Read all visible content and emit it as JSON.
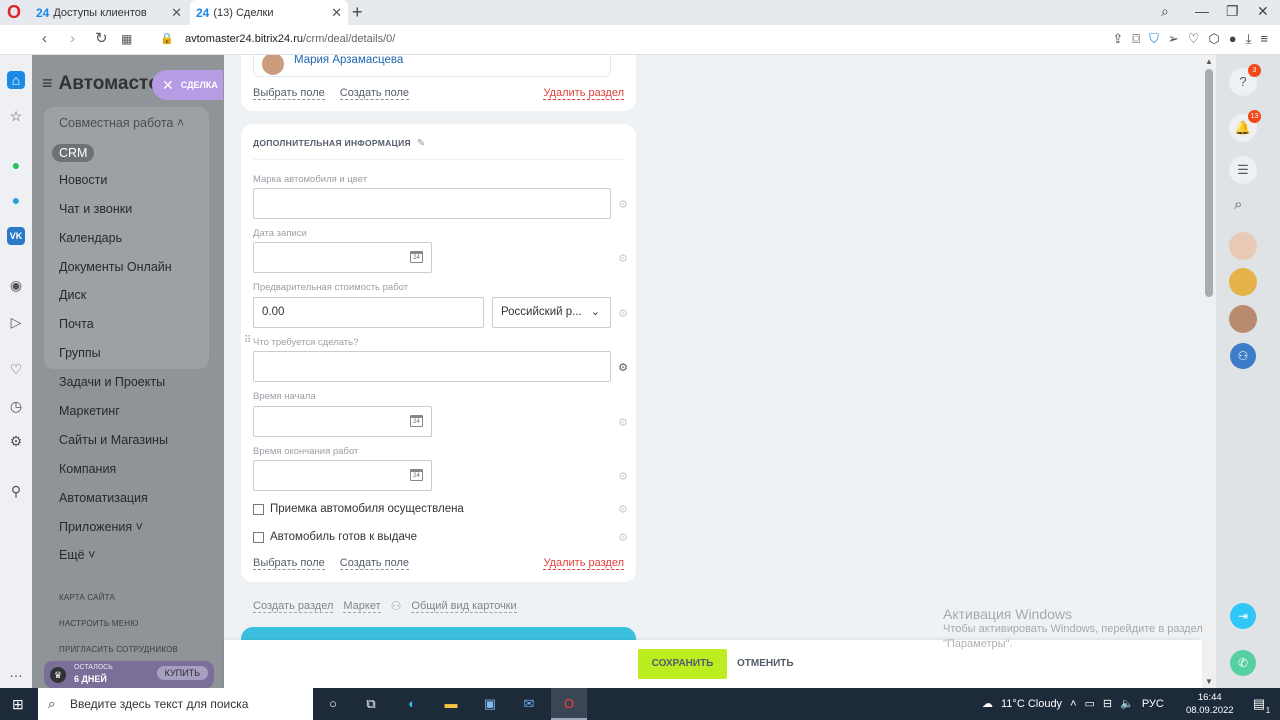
{
  "browser": {
    "tabs": [
      {
        "icon_text": "24",
        "title": "Доступы клиентов",
        "active": false
      },
      {
        "icon_text": "24",
        "title": "(13) Сделки",
        "active": true
      }
    ],
    "url_host": "avtomaster24.bitrix24.ru",
    "url_path": "/crm/deal/details/0/"
  },
  "leftmenu": {
    "brand": "Автомастер",
    "group_label": "Совместная работа",
    "group_items": [
      "CRM",
      "Новости",
      "Чат и звонки",
      "Календарь",
      "Документы Онлайн",
      "Диск",
      "Почта",
      "Группы"
    ],
    "items": [
      "Задачи и Проекты",
      "Маркетинг",
      "Сайты и Магазины",
      "Компания",
      "Автоматизация",
      "Приложения",
      "Ещё"
    ],
    "small_links": [
      "КАРТА САЙТА",
      "НАСТРОИТЬ МЕНЮ",
      "ПРИГЛАСИТЬ СОТРУДНИКОВ"
    ],
    "promo": {
      "line1": "ОСТАЛОСЬ",
      "line2": "6 ДНЕЙ",
      "buy": "КУПИТЬ"
    }
  },
  "slider_chip": {
    "label": "СДЕЛКА"
  },
  "card1": {
    "person_name": "Мария Арзамасцева",
    "select_field": "Выбрать поле",
    "create_field": "Создать поле",
    "delete_section": "Удалить раздел"
  },
  "card2": {
    "title": "ДОПОЛНИТЕЛЬНАЯ ИНФОРМАЦИЯ",
    "fields": {
      "car_label": "Марка автомобиля и цвет",
      "date_label": "Дата записи",
      "cost_label": "Предварительная стоимость работ",
      "cost_value": "0.00",
      "currency_value": "Российский р...",
      "todo_label": "Что требуется сделать?",
      "start_label": "Время начала",
      "end_label": "Время окончания работ",
      "check1": "Приемка автомобиля осуществлена",
      "check2": "Автомобиль готов к выдаче"
    },
    "select_field": "Выбрать поле",
    "create_field": "Создать поле",
    "delete_section": "Удалить раздел"
  },
  "bottom_links": {
    "create_section": "Создать раздел",
    "market": "Маркет",
    "card_view": "Общий вид карточки"
  },
  "savebar": {
    "save": "СОХРАНИТЬ",
    "cancel": "ОТМЕНИТЬ"
  },
  "watermark": {
    "title": "Активация Windows",
    "line1": "Чтобы активировать Windows, перейдите в раздел",
    "line2": "\"Параметры\"."
  },
  "rightpanel": {
    "help_badge": "3",
    "notif_badge": "13"
  },
  "taskbar": {
    "search_placeholder": "Введите здесь текст для поиска",
    "weather": "11°C  Cloudy",
    "lang": "РУС",
    "time": "16:44",
    "date": "08.09.2022",
    "notif_count": "1"
  },
  "colors": {
    "accent": "#1b8ae6",
    "save": "#bbed21",
    "danger": "#e0413b",
    "chip": "#b69be5"
  }
}
